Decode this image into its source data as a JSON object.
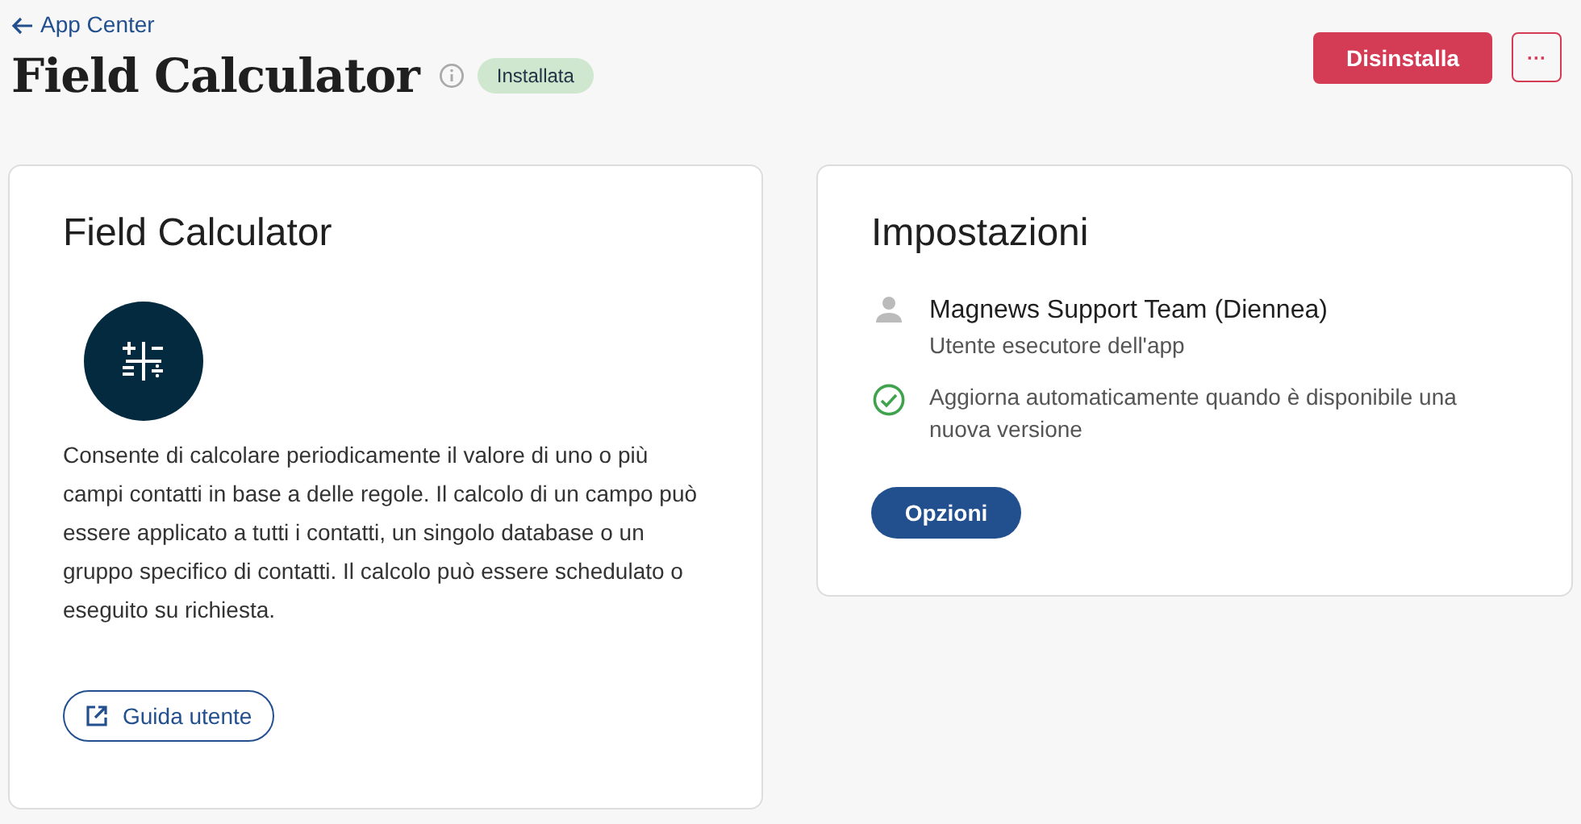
{
  "back_link": "App Center",
  "header": {
    "title": "Field Calculator",
    "status": "Installata",
    "uninstall": "Disinstalla",
    "more": "···"
  },
  "app_card": {
    "title": "Field Calculator",
    "description": "Consente di calcolare periodicamente il valore di uno o più campi contatti in base a delle regole. Il calcolo di un campo può essere applicato a tutti i contatti, un singolo database o un gruppo specifico di contatti. Il calcolo può essere schedulato o eseguito su richiesta.",
    "guide": "Guida utente"
  },
  "settings": {
    "title": "Impostazioni",
    "items": [
      {
        "kind": "user",
        "name": "Magnews Support Team (Diennea)",
        "note": "Utente esecutore dell'app"
      },
      {
        "kind": "option",
        "checked": true,
        "name": "Aggiorna automaticamente quando è disponibile una nuova versione"
      }
    ],
    "button": "Opzioni"
  }
}
